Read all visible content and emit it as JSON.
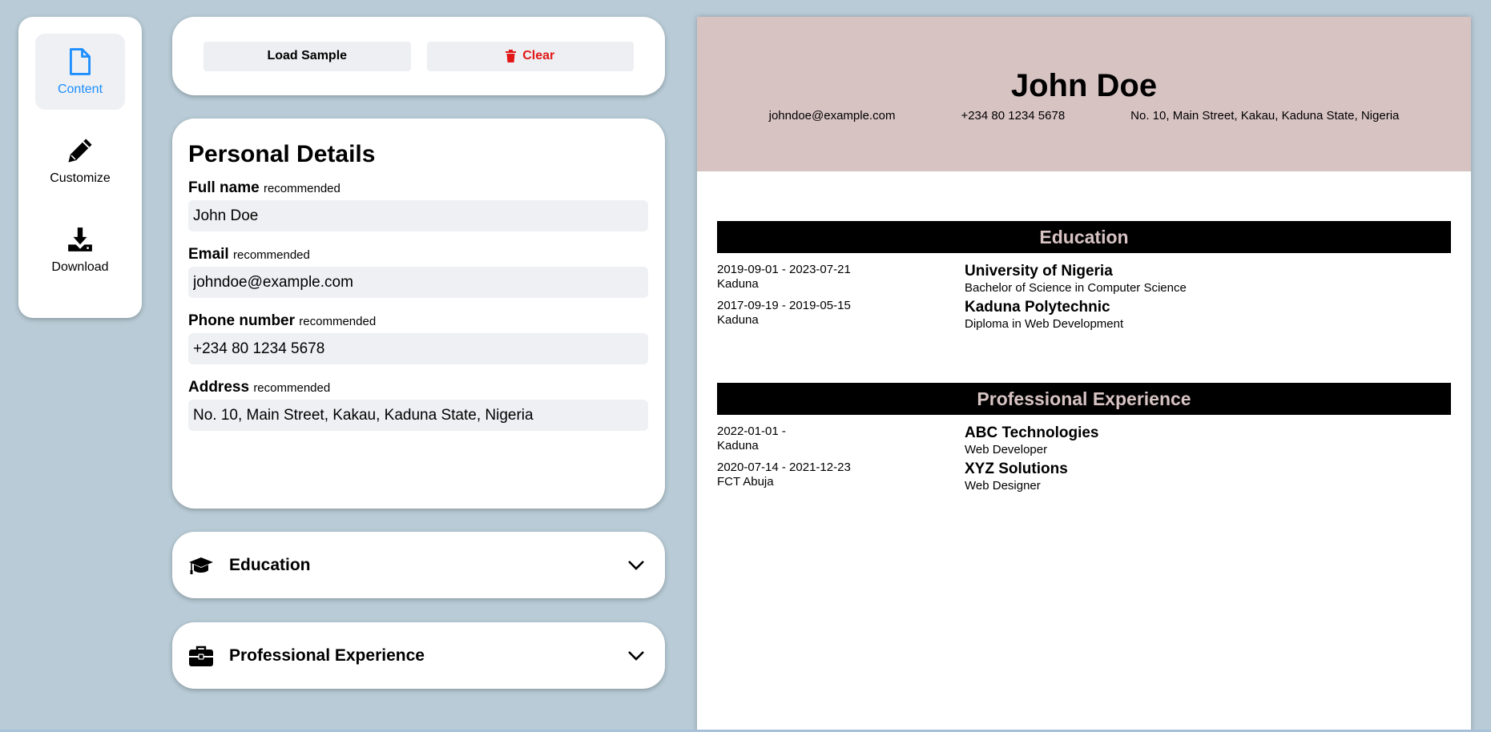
{
  "nav": {
    "items": [
      {
        "label": "Content"
      },
      {
        "label": "Customize"
      },
      {
        "label": "Download"
      }
    ]
  },
  "actions": {
    "load_sample": "Load Sample",
    "clear": "Clear"
  },
  "personal": {
    "title": "Personal Details",
    "fields": [
      {
        "label": "Full name",
        "hint": "recommended",
        "value": "John Doe"
      },
      {
        "label": "Email",
        "hint": "recommended",
        "value": "johndoe@example.com"
      },
      {
        "label": "Phone number",
        "hint": "recommended",
        "value": "+234 80 1234 5678"
      },
      {
        "label": "Address",
        "hint": "recommended",
        "value": "No. 10, Main Street, Kakau, Kaduna State, Nigeria"
      }
    ]
  },
  "accordions": {
    "education": "Education",
    "experience": "Professional Experience"
  },
  "resume": {
    "name": "John Doe",
    "email": "johndoe@example.com",
    "phone": "+234 80 1234 5678",
    "address": "No. 10, Main Street, Kakau, Kaduna State, Nigeria",
    "education_title": "Education",
    "education": [
      {
        "dates": "2019-09-01 - 2023-07-21",
        "location": "Kaduna",
        "school": "University of Nigeria",
        "degree": "Bachelor of Science in Computer Science"
      },
      {
        "dates": "2017-09-19 - 2019-05-15",
        "location": "Kaduna",
        "school": "Kaduna Polytechnic",
        "degree": "Diploma in Web Development"
      }
    ],
    "experience_title": "Professional Experience",
    "experience": [
      {
        "dates": "2022-01-01 -",
        "location": "Kaduna",
        "company": "ABC Technologies",
        "role": "Web Developer"
      },
      {
        "dates": "2020-07-14 - 2021-12-23",
        "location": "FCT Abuja",
        "company": "XYZ Solutions",
        "role": "Web Designer"
      }
    ]
  },
  "colors": {
    "accent": "#1e8fff",
    "danger": "#e21818",
    "resume_header_bg": "#d8c3c3",
    "section_bar_bg": "#000000",
    "page_bg": "#b8cbd6"
  }
}
